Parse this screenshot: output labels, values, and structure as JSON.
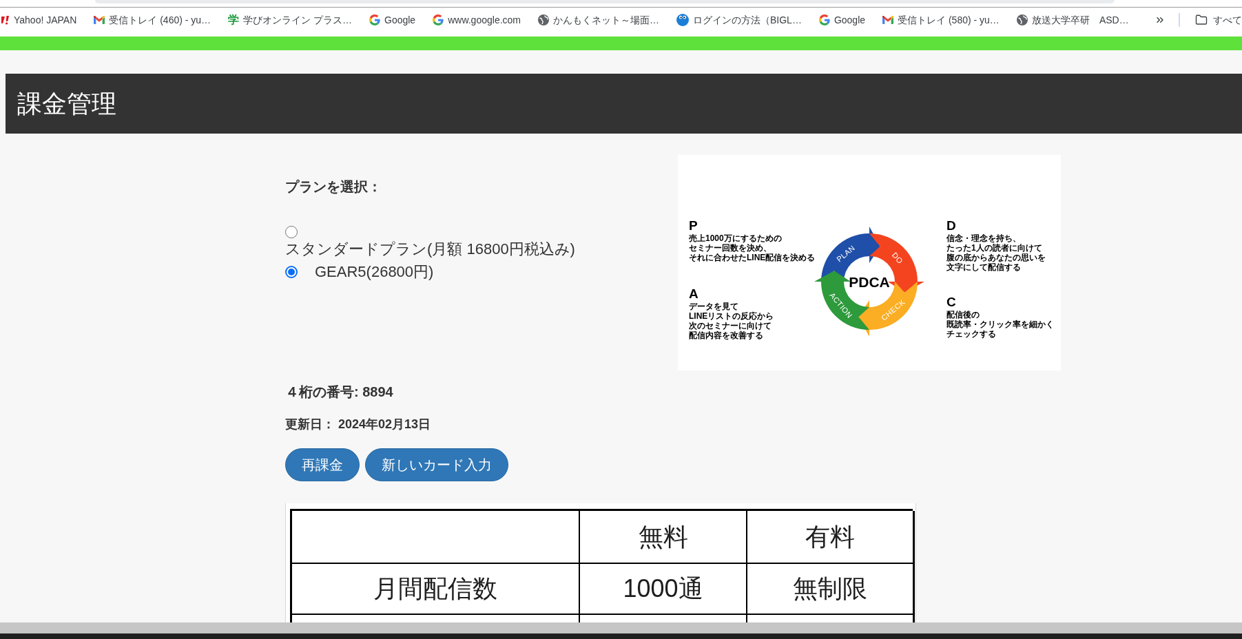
{
  "browser": {
    "bookmarks": [
      {
        "kind": "favicon",
        "label": "Yahoo! JAPAN"
      },
      {
        "kind": "mail",
        "label": "受信トレイ (460) - yu…"
      },
      {
        "kind": "glyph",
        "glyph": "学",
        "label": "学びオンライン プラス…"
      },
      {
        "kind": "g",
        "label": "Google"
      },
      {
        "kind": "g",
        "label": "www.google.com"
      },
      {
        "kind": "globe",
        "label": "かんもくネット～場面…"
      },
      {
        "kind": "mascot",
        "label": "ログインの方法（BIGL…"
      },
      {
        "kind": "g",
        "label": "Google"
      },
      {
        "kind": "mail",
        "label": "受信トレイ (580) - yu…"
      },
      {
        "kind": "globe",
        "label": "放送大学卒研　ASD…"
      }
    ],
    "all_bookmarks": "すべて"
  },
  "header": {
    "title": "課金管理"
  },
  "plan_section": {
    "label": "プランを選択：",
    "plans": [
      {
        "label": "スタンダードプラン(月額 16800円税込み)",
        "selected": false
      },
      {
        "label": "GEAR5(26800円)",
        "selected": true
      }
    ]
  },
  "pdca_image": {
    "notes_left": [
      {
        "letter": "P",
        "lines": [
          "売上1000万にするための",
          "セミナー回数を決め、",
          "それに合わせたLINE配信を決める"
        ]
      },
      {
        "letter": "A",
        "lines": [
          "データを見て",
          "LINEリストの反応から",
          "次のセミナーに向けて",
          "配信内容を改善する"
        ]
      }
    ],
    "stages": [
      {
        "label": "PLAN",
        "color": "#1f4fa8"
      },
      {
        "label": "DO",
        "color": "#f4441f"
      },
      {
        "label": "CHECK",
        "color": "#fbad23"
      },
      {
        "label": "ACTION",
        "color": "#2d9a3b"
      }
    ],
    "center": "PDCA",
    "notes_right": [
      {
        "letter": "D",
        "lines": [
          "信念・理念を持ち、",
          "たった1人の読者に向けて",
          "腹の底からあなたの思いを",
          "文字にして配信する"
        ]
      },
      {
        "letter": "C",
        "lines": [
          "配信後の",
          "既読率・クリック率を細かく",
          "チェックする"
        ]
      }
    ]
  },
  "account": {
    "number": "４桁の番号: 8894",
    "updated": "更新日： 2024年02月13日"
  },
  "buttons": [
    "再課金",
    "新しいカード入力"
  ],
  "price_table_image": {
    "header": [
      "無料",
      "有料"
    ],
    "rows": [
      {
        "label": "月間配信数",
        "cells": [
          "1000通",
          "無制限"
        ]
      }
    ]
  }
}
